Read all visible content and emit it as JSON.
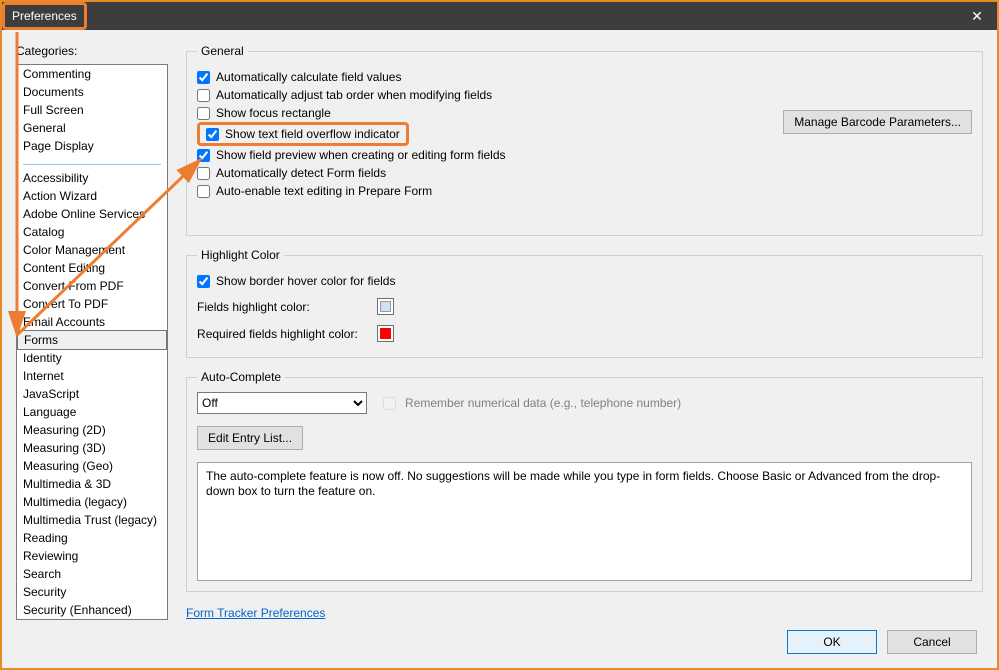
{
  "window": {
    "title": "Preferences"
  },
  "categories": {
    "label": "Categories:",
    "group1": [
      "Commenting",
      "Documents",
      "Full Screen",
      "General",
      "Page Display"
    ],
    "group2": [
      "Accessibility",
      "Action Wizard",
      "Adobe Online Services",
      "Catalog",
      "Color Management",
      "Content Editing",
      "Convert From PDF",
      "Convert To PDF",
      "Email Accounts",
      "Forms",
      "Identity",
      "Internet",
      "JavaScript",
      "Language",
      "Measuring (2D)",
      "Measuring (3D)",
      "Measuring (Geo)",
      "Multimedia & 3D",
      "Multimedia (legacy)",
      "Multimedia Trust (legacy)",
      "Reading",
      "Reviewing",
      "Search",
      "Security",
      "Security (Enhanced)"
    ],
    "selected": "Forms"
  },
  "general": {
    "legend": "General",
    "items": [
      {
        "label": "Automatically calculate field values",
        "checked": true
      },
      {
        "label": "Automatically adjust tab order when modifying fields",
        "checked": false
      },
      {
        "label": "Show focus rectangle",
        "checked": false
      },
      {
        "label": "Show text field overflow indicator",
        "checked": true,
        "highlighted": true
      },
      {
        "label": "Show field preview when creating or editing form fields",
        "checked": true
      },
      {
        "label": "Automatically detect Form fields",
        "checked": false
      },
      {
        "label": "Auto-enable text editing in Prepare Form",
        "checked": false
      }
    ],
    "barcode_btn": "Manage Barcode Parameters..."
  },
  "highlight": {
    "legend": "Highlight Color",
    "border_hover": {
      "label": "Show border hover color for fields",
      "checked": true
    },
    "fields_label": "Fields highlight color:",
    "required_label": "Required fields highlight color:"
  },
  "autocomplete": {
    "legend": "Auto-Complete",
    "mode": "Off",
    "remember": "Remember numerical data (e.g., telephone number)",
    "edit_entries": "Edit Entry List...",
    "desc": "The auto-complete feature is now off. No suggestions will be made while you type in form fields. Choose Basic or Advanced from the drop-down box to turn the feature on."
  },
  "tracker_link": "Form Tracker Preferences",
  "buttons": {
    "ok": "OK",
    "cancel": "Cancel"
  }
}
